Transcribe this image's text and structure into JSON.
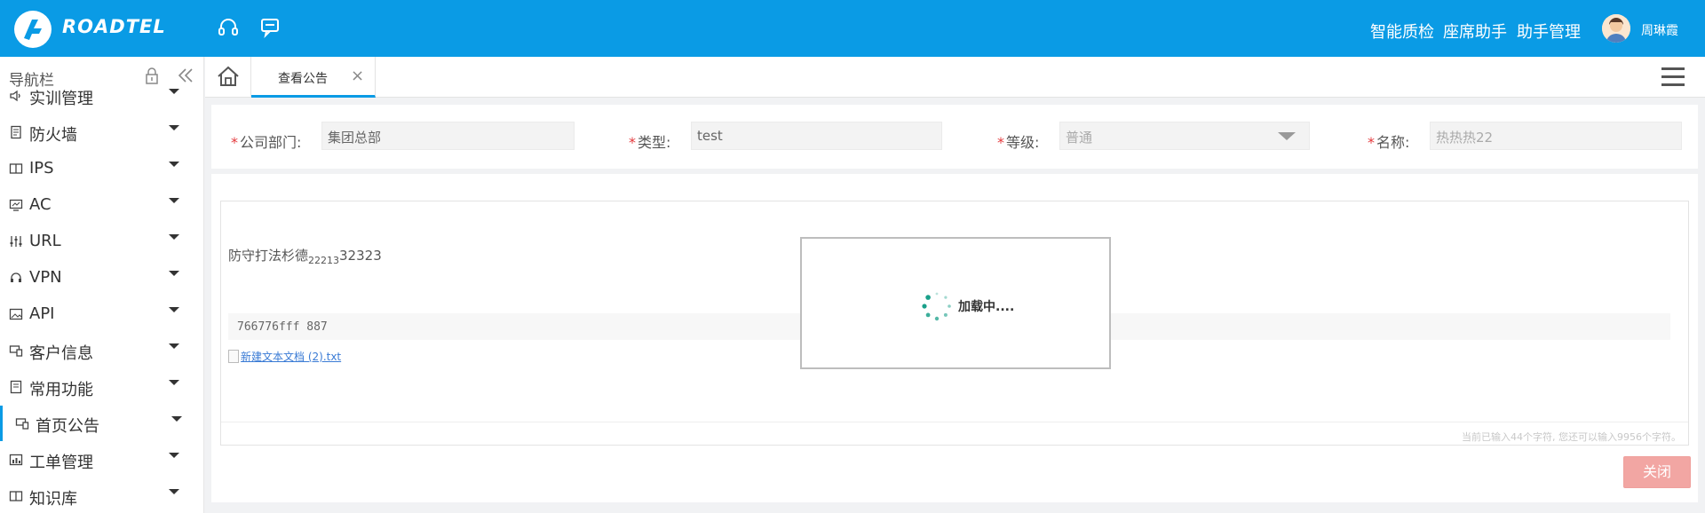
{
  "header": {
    "brand": "ROADTEL",
    "menu": [
      "智能质检",
      "座席助手",
      "助手管理"
    ],
    "username": "周琳霞",
    "icons": [
      "headset-icon",
      "chat-icon"
    ]
  },
  "sidebar": {
    "title": "导航栏",
    "items": [
      {
        "label": "实训管理",
        "icon": "speaker-icon"
      },
      {
        "label": "防火墙",
        "icon": "document-icon"
      },
      {
        "label": "IPS",
        "icon": "book-icon"
      },
      {
        "label": "AC",
        "icon": "monitor-icon"
      },
      {
        "label": "URL",
        "icon": "sliders-icon"
      },
      {
        "label": "VPN",
        "icon": "headset-icon"
      },
      {
        "label": "API",
        "icon": "image-icon"
      },
      {
        "label": "客户信息",
        "icon": "devices-icon"
      },
      {
        "label": "常用功能",
        "icon": "note-icon"
      },
      {
        "label": "首页公告",
        "icon": "devices-icon",
        "active": true
      },
      {
        "label": "工单管理",
        "icon": "chart-icon"
      },
      {
        "label": "知识库",
        "icon": "book-icon"
      }
    ]
  },
  "tabs": {
    "active_label": "查看公告",
    "close_symbol": "×"
  },
  "form": {
    "department_label": "公司部门:",
    "department_value": "集团总部",
    "type_label": "类型:",
    "type_value": "test",
    "level_label": "等级:",
    "level_value": "普通",
    "name_label": "名称:",
    "name_value": "热热热22",
    "required_mark": "*"
  },
  "editor": {
    "text_main": "防守打法杉德",
    "text_sub_a": "2",
    "text_sub_b": "2213",
    "text_tail": "32323",
    "code_line": "766776fff  887",
    "attachment": "新建文本文档 (2).txt",
    "counter": "当前已输入44个字符, 您还可以输入9956个字符。"
  },
  "actions": {
    "close_label": "关闭"
  },
  "loading": {
    "text": "加载中...."
  },
  "colors": {
    "header_bg": "#0a9be5",
    "accent": "#0a9be5",
    "required": "#e4393c",
    "close_button": "#f2a6a3",
    "spinner": "#1aa08a"
  }
}
